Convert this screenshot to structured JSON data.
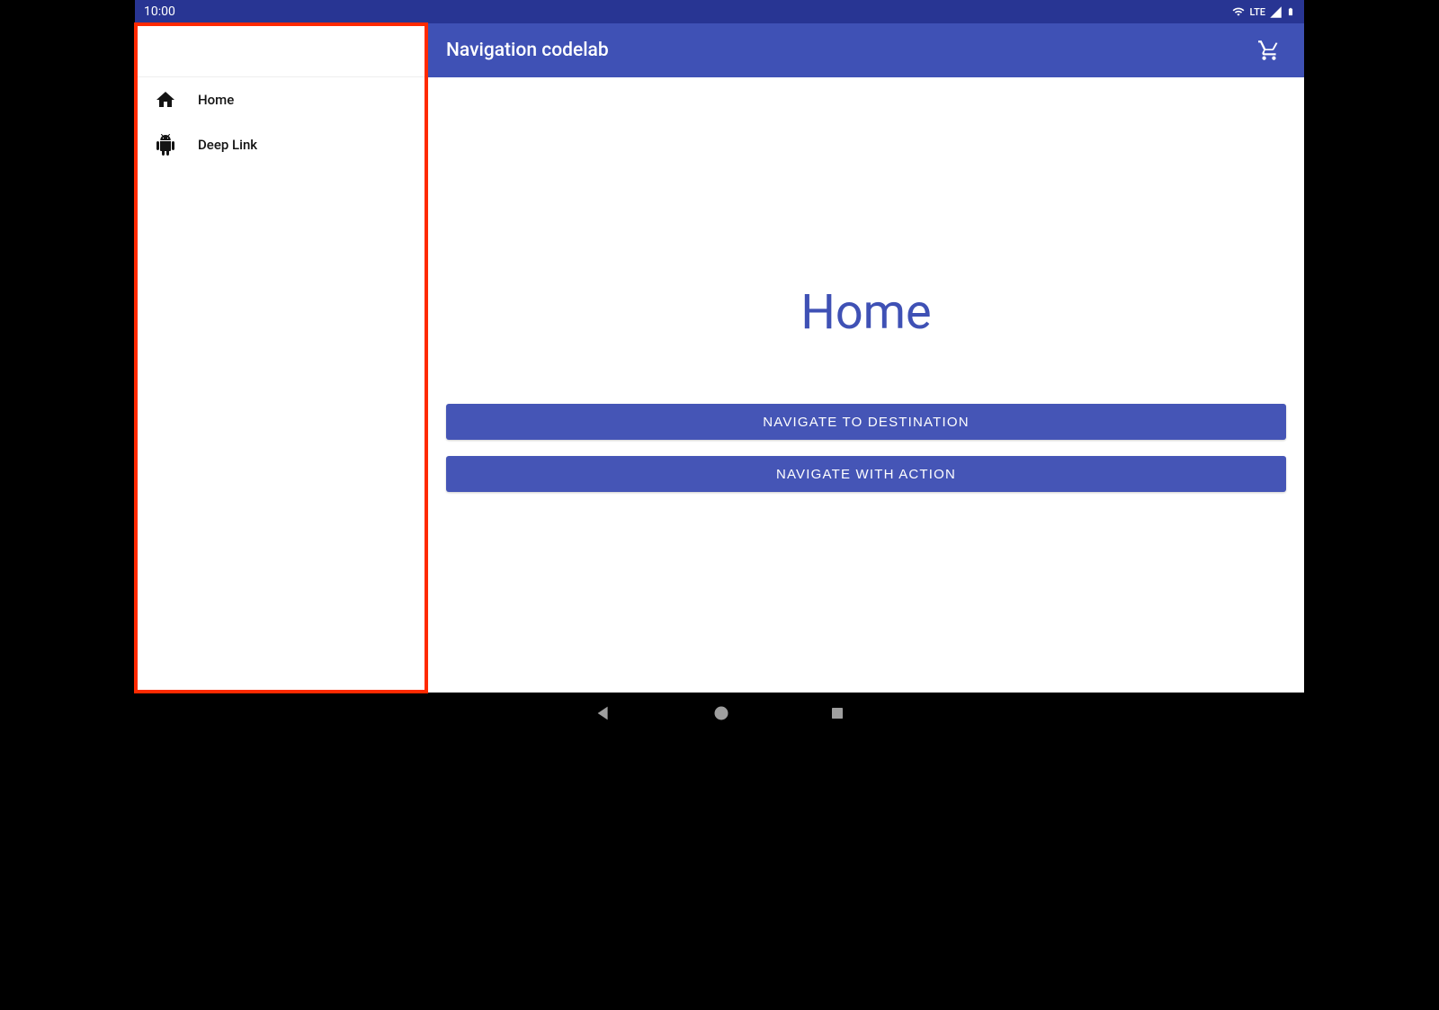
{
  "status_bar": {
    "time": "10:00",
    "network_label": "LTE"
  },
  "sidebar": {
    "items": [
      {
        "label": "Home"
      },
      {
        "label": "Deep Link"
      }
    ]
  },
  "app_bar": {
    "title": "Navigation codelab"
  },
  "content": {
    "heading": "Home",
    "buttons": {
      "nav_destination": "Navigate to Destination",
      "nav_action": "Navigate with Action"
    }
  },
  "colors": {
    "primary": "#3f51b5",
    "primary_dark": "#283593",
    "accent_button": "#4555b6",
    "highlight": "#ff2a00"
  }
}
